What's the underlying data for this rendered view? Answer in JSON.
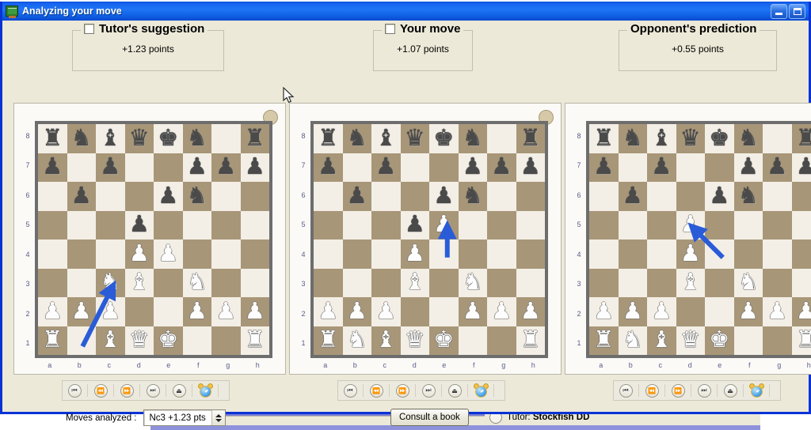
{
  "window": {
    "title": "Analyzing your move",
    "icon": "chalkboard-icon",
    "minimize_label": "Minimize",
    "maximize_label": "Maximize"
  },
  "panels": [
    {
      "id": "tutor-suggestion",
      "title": "Tutor's suggestion",
      "score": "+1.23 points",
      "has_checkbox": true,
      "checked": false
    },
    {
      "id": "your-move",
      "title": "Your move",
      "score": "+1.07 points",
      "has_checkbox": true,
      "checked": false
    },
    {
      "id": "opponent-prediction",
      "title": "Opponent's prediction",
      "score": "+0.55 points",
      "has_checkbox": false,
      "checked": false
    }
  ],
  "board_labels": {
    "files": [
      "a",
      "b",
      "c",
      "d",
      "e",
      "f",
      "g",
      "h"
    ],
    "ranks": [
      "8",
      "7",
      "6",
      "5",
      "4",
      "3",
      "2",
      "1"
    ]
  },
  "boards": [
    {
      "id": "board-tutor-suggestion",
      "side_to_move_indicator": "light",
      "arrow": {
        "from": "b1",
        "to": "c3",
        "color": "#2a5cd8"
      },
      "ranks": [
        [
          "r",
          "n",
          "b",
          "q",
          "k",
          "n",
          "",
          "r"
        ],
        [
          "p",
          "",
          "p",
          "",
          "",
          "p",
          "p",
          "p"
        ],
        [
          "",
          "p",
          "",
          "",
          "p",
          "n",
          "",
          ""
        ],
        [
          "",
          "",
          "",
          "p",
          "",
          "",
          "",
          ""
        ],
        [
          "",
          "",
          "",
          "P",
          "P",
          "",
          "",
          ""
        ],
        [
          "",
          "",
          "N",
          "B",
          "",
          "N",
          "",
          ""
        ],
        [
          "P",
          "P",
          "P",
          "",
          "",
          "P",
          "P",
          "P"
        ],
        [
          "R",
          "",
          "B",
          "Q",
          "K",
          "",
          "",
          "R"
        ]
      ]
    },
    {
      "id": "board-your-move",
      "side_to_move_indicator": "light",
      "arrow": {
        "from": "e4",
        "to": "e5",
        "color": "#2a5cd8"
      },
      "ranks": [
        [
          "r",
          "n",
          "b",
          "q",
          "k",
          "n",
          "",
          "r"
        ],
        [
          "p",
          "",
          "p",
          "",
          "",
          "p",
          "p",
          "p"
        ],
        [
          "",
          "p",
          "",
          "",
          "p",
          "n",
          "",
          ""
        ],
        [
          "",
          "",
          "",
          "p",
          "P",
          "",
          "",
          ""
        ],
        [
          "",
          "",
          "",
          "P",
          "",
          "",
          "",
          ""
        ],
        [
          "",
          "",
          "",
          "B",
          "",
          "N",
          "",
          ""
        ],
        [
          "P",
          "P",
          "P",
          "",
          "",
          "P",
          "P",
          "P"
        ],
        [
          "R",
          "N",
          "B",
          "Q",
          "K",
          "",
          "",
          "R"
        ]
      ]
    },
    {
      "id": "board-opponent-prediction",
      "side_to_move_indicator": "light",
      "arrow": {
        "from": "e4",
        "to": "d5",
        "color": "#2a5cd8"
      },
      "ranks": [
        [
          "r",
          "n",
          "b",
          "q",
          "k",
          "n",
          "",
          "r"
        ],
        [
          "p",
          "",
          "p",
          "",
          "",
          "p",
          "p",
          "p"
        ],
        [
          "",
          "p",
          "",
          "",
          "p",
          "n",
          "",
          ""
        ],
        [
          "",
          "",
          "",
          "P",
          "",
          "",
          "",
          ""
        ],
        [
          "",
          "",
          "",
          "P",
          "",
          "",
          "",
          ""
        ],
        [
          "",
          "",
          "",
          "B",
          "",
          "N",
          "",
          ""
        ],
        [
          "P",
          "P",
          "P",
          "",
          "",
          "P",
          "P",
          "P"
        ],
        [
          "R",
          "N",
          "B",
          "Q",
          "K",
          "",
          "",
          "R"
        ]
      ]
    }
  ],
  "toolbar": {
    "buttons": [
      {
        "name": "first-move-button",
        "glyph": "⏮",
        "title": "First move"
      },
      {
        "name": "previous-move-button",
        "glyph": "⏪",
        "title": "Previous move"
      },
      {
        "name": "next-move-button",
        "glyph": "⏩",
        "title": "Next move"
      },
      {
        "name": "last-move-button",
        "glyph": "⏭",
        "title": "Last move"
      },
      {
        "name": "eject-button",
        "glyph": "⏏",
        "title": "Eject"
      },
      {
        "name": "clock-button",
        "glyph": "alarm-clock-icon",
        "title": "Clock"
      }
    ]
  },
  "controls": {
    "moves_analyzed_label": "Moves analyzed :",
    "moves_analyzed_value": "Nc3 +1.23 pts",
    "consult_book_label": "Consult a book"
  },
  "status": {
    "tutor_prefix": "Tutor:",
    "tutor_engine": "Stockfish DD"
  },
  "colors": {
    "titlebar": "#1563ed",
    "window_border": "#0a33d6",
    "client_bg": "#ece9d8",
    "board_light": "#f3efe6",
    "board_dark": "#a89678",
    "board_frame": "#6d6d6d",
    "arrow": "#2a5cd8",
    "label": "#5b5b8a"
  }
}
